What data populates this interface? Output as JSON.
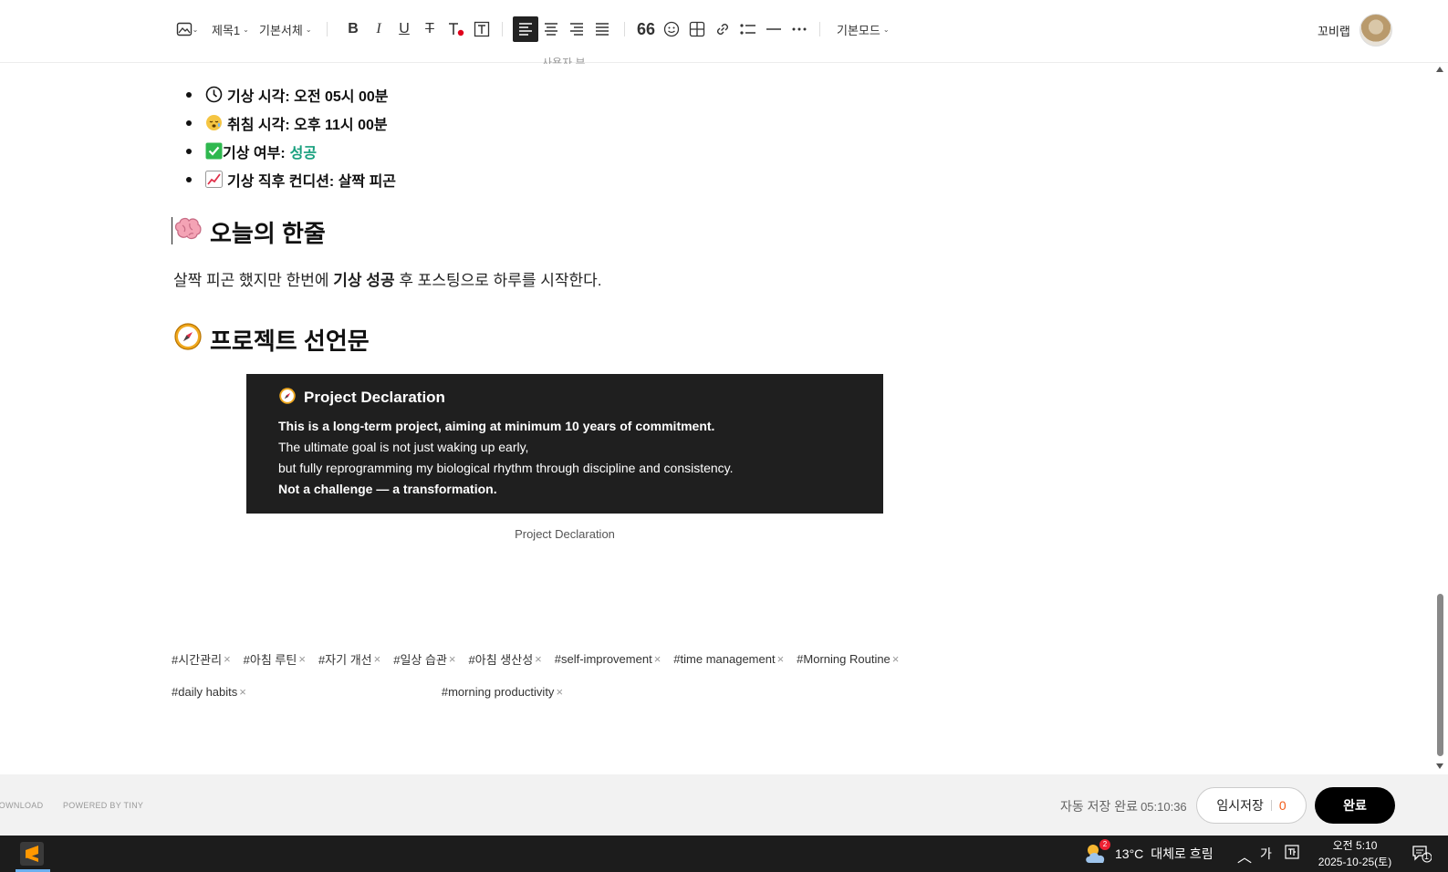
{
  "toolbar": {
    "heading_label": "제목1",
    "font_label": "기본서체",
    "mode_label": "기본모드",
    "user_name": "꼬비랩"
  },
  "editor": {
    "cut_text": "사용자 뷰",
    "status_items": [
      {
        "label": "기상 시각: 오전 05시 00분",
        "icon": "clock-icon"
      },
      {
        "label": "취침 시각: 오후 11시 00분",
        "icon": "sleepy-face-icon"
      },
      {
        "label": "기상 여부:",
        "value": "성공",
        "icon": "check-box-icon"
      },
      {
        "label": "기상 직후 컨디션: 살짝 피곤",
        "icon": "chart-increasing-icon"
      }
    ],
    "section1_title": "오늘의 한줄",
    "paragraph": {
      "before": "살짝 피곤 했지만 한번에 ",
      "bold": "기상 성공",
      "after": " 후 포스팅으로 하루를 시작한다."
    },
    "section2_title": "프로젝트 선언문",
    "declaration": {
      "title": "Project Declaration",
      "lines": [
        {
          "text": "This is a long-term project, aiming at minimum 10 years of commitment.",
          "bold": true
        },
        {
          "text": "The ultimate goal is not just waking up early,",
          "bold": false
        },
        {
          "text": "but fully reprogramming my biological rhythm through discipline and consistency.",
          "bold": false
        },
        {
          "text": "Not a challenge — a transformation.",
          "bold": true
        }
      ],
      "caption": "Project Declaration"
    },
    "tags": [
      "#시간관리",
      "#아침 루틴",
      "#자기 개선",
      "#일상 습관",
      "#아침 생산성",
      "#self-improvement",
      "#time management",
      "#Morning Routine",
      "#daily habits",
      "#morning productivity"
    ]
  },
  "footer": {
    "download_text": "DOWNLOAD",
    "powered_text": "POWERED BY TINY",
    "autosave_label": "자동 저장 완료",
    "autosave_time": "05:10:36",
    "draft_label": "임시저장",
    "draft_count": "0",
    "done_label": "완료"
  },
  "taskbar": {
    "weather_badge": "2",
    "temperature": "13°C",
    "weather_text": "대체로 흐림",
    "ime_label": "가",
    "time": "오전 5:10",
    "date": "2025-10-25(토)",
    "notif_count": "1"
  },
  "colors": {
    "accent_green": "#18a07e",
    "draft_count": "#f25c19",
    "declaration_bg": "#1f1f1f"
  }
}
